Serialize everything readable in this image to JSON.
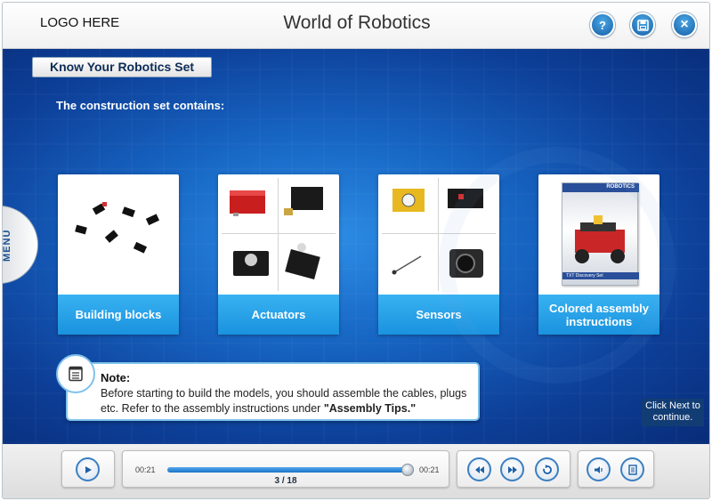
{
  "header": {
    "logo": "LOGO HERE",
    "title": "World of Robotics",
    "buttons": [
      {
        "name": "help",
        "glyph": "?"
      },
      {
        "name": "save",
        "icon": "save-icon"
      },
      {
        "name": "close",
        "glyph": "×"
      }
    ]
  },
  "content": {
    "section_title": "Know Your Robotics Set",
    "intro": "The construction set contains:",
    "menu_label": "MENU",
    "cards": [
      {
        "label": "Building blocks"
      },
      {
        "label": "Actuators"
      },
      {
        "label": "Sensors"
      },
      {
        "label": "Colored assembly instructions",
        "cover_text": "ROBOTICS",
        "cover_subtitle": "TXT Discovery Set"
      }
    ],
    "note": {
      "title": "Note:",
      "body_part1": "Before starting to build the models, you should assemble the cables, plugs etc. Refer to the assembly instructions under ",
      "body_bold": "\"Assembly Tips.\""
    },
    "next_hint": "Click Next to continue."
  },
  "player": {
    "time_elapsed": "00:21",
    "time_total": "00:21",
    "progress_fraction": 0.98,
    "page_indicator": "3 / 18"
  },
  "colors": {
    "accent": "#1a92de",
    "button_blue": "#155fa5",
    "background_blue": "#1766c4"
  }
}
